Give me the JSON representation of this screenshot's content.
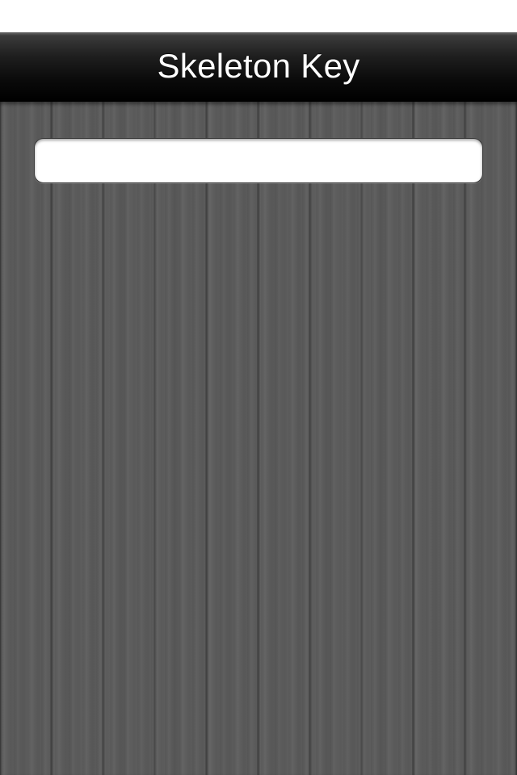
{
  "nav": {
    "title": "Skeleton Key"
  },
  "search": {
    "value": "",
    "placeholder": ""
  },
  "colors": {
    "nav_background": "#000000",
    "nav_title": "#ffffff",
    "wood_background": "#5b5b5b",
    "input_background": "#ffffff"
  }
}
